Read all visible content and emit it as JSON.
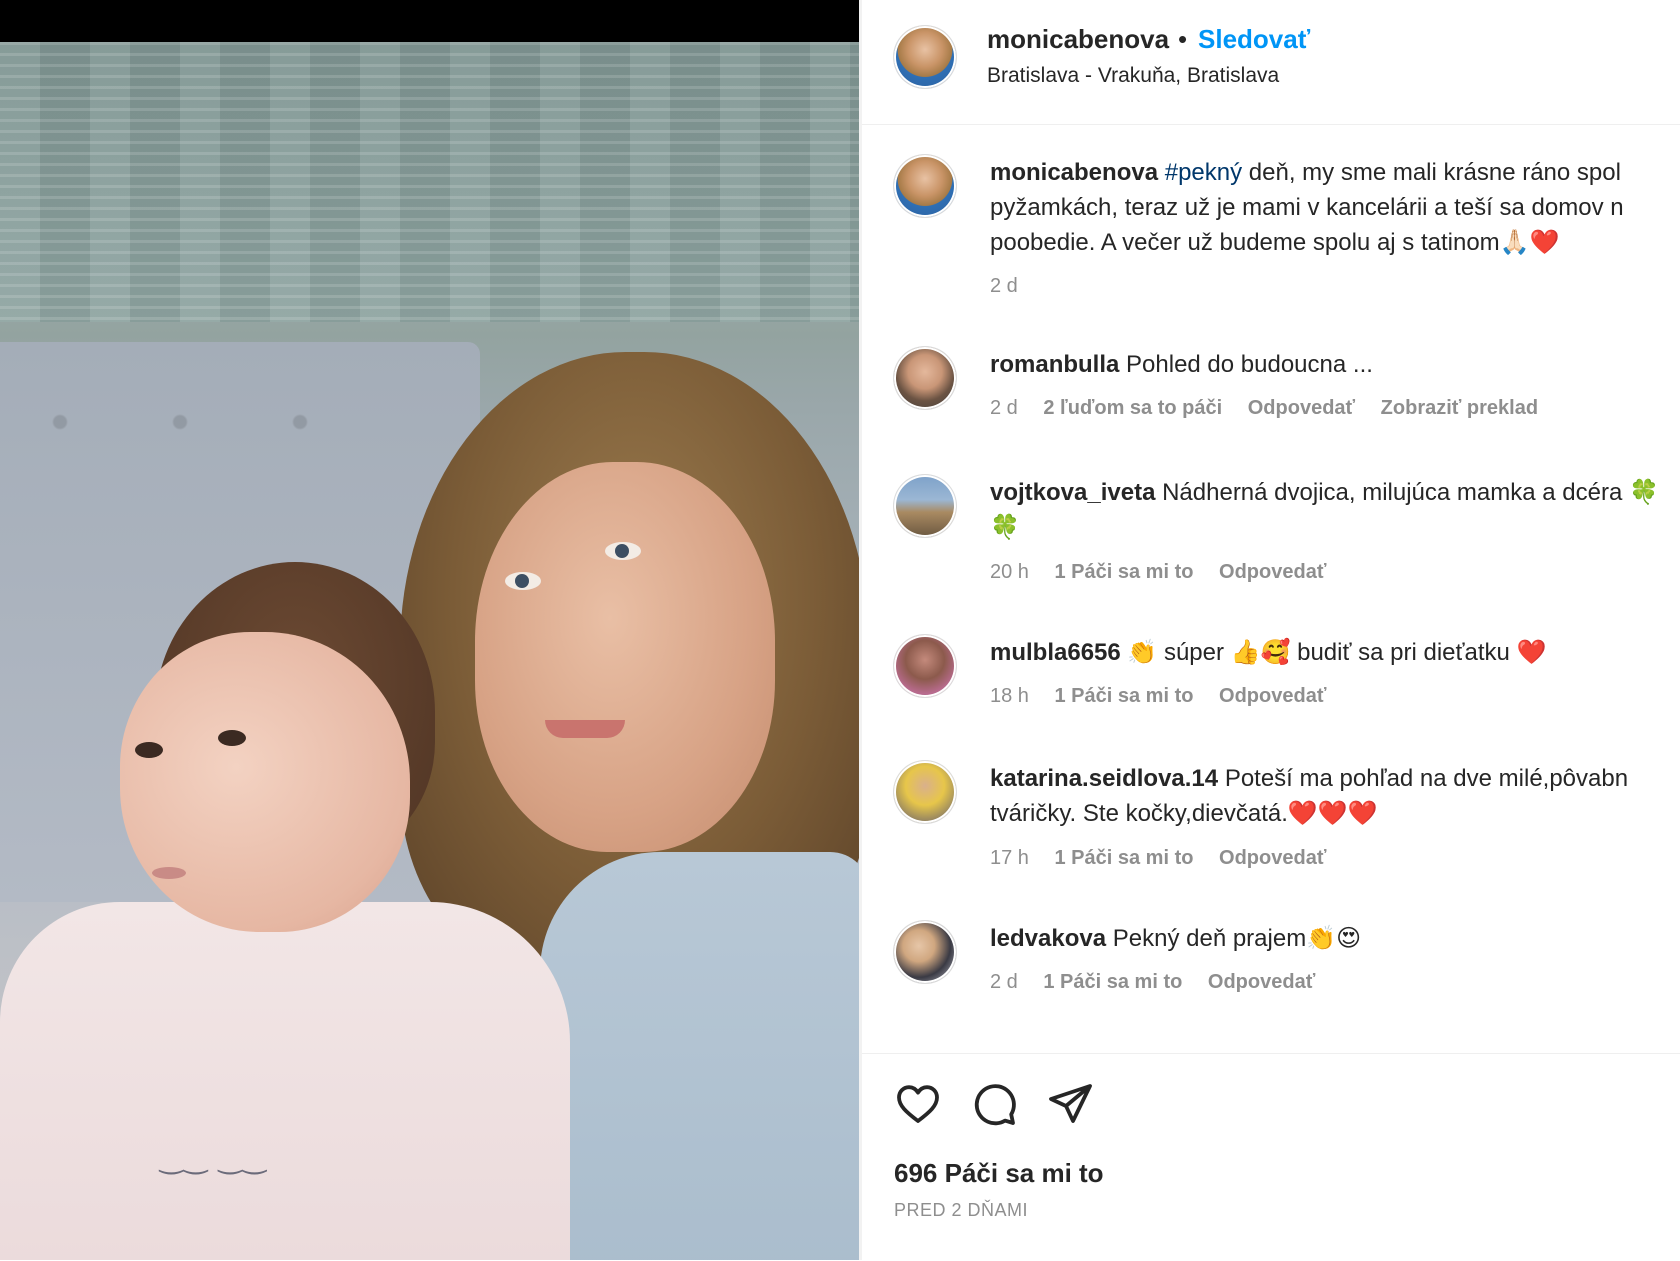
{
  "post": {
    "username": "monicabenova",
    "follow_label": "Sledovať",
    "location": "Bratislava - Vrakuňa, Bratislava"
  },
  "caption": {
    "username": "monicabenova",
    "hashtag": "#pekný",
    "text": "deň, my sme mali krásne ráno spol pyžamkách, teraz už je mami v kancelárii a teší sa domov n poobedie. A večer už budeme spolu aj s tatinom🙏🏻❤️",
    "time": "2 d"
  },
  "comments": [
    {
      "username": "romanbulla",
      "text": "Pohled do budoucna ...",
      "time": "2 d",
      "likes": "2 ľuďom sa to páči",
      "reply": "Odpovedať",
      "translate": "Zobraziť preklad"
    },
    {
      "username": "vojtkova_iveta",
      "text": "Nádherná dvojica, milujúca mamka a dcéra 🍀🍀",
      "time": "20 h",
      "likes": "1 Páči sa mi to",
      "reply": "Odpovedať"
    },
    {
      "username": "mulbla6656",
      "text": "👏 súper 👍🥰 budiť sa pri dieťatku ❤️",
      "time": "18 h",
      "likes": "1 Páči sa mi to",
      "reply": "Odpovedať"
    },
    {
      "username": "katarina.seidlova.14",
      "text": "Poteší ma pohľad na dve milé,pôvabn tváričky. Ste kočky,dievčatá.❤️❤️❤️",
      "time": "17 h",
      "likes": "1 Páči sa mi to",
      "reply": "Odpovedať"
    },
    {
      "username": "ledvakova",
      "text": "Pekný deň prajem👏😍",
      "time": "2 d",
      "likes": "1 Páči sa mi to",
      "reply": "Odpovedať"
    }
  ],
  "footer": {
    "likes": "696 Páči sa mi to",
    "date": "PRED 2 DŇAMI"
  },
  "icons": {
    "like": "heart-outline-icon",
    "comment": "comment-bubble-icon",
    "share": "paper-plane-icon"
  },
  "colors": {
    "link": "#0095f6",
    "hashtag": "#00376b",
    "muted": "#8e8e8e",
    "text": "#262626"
  }
}
